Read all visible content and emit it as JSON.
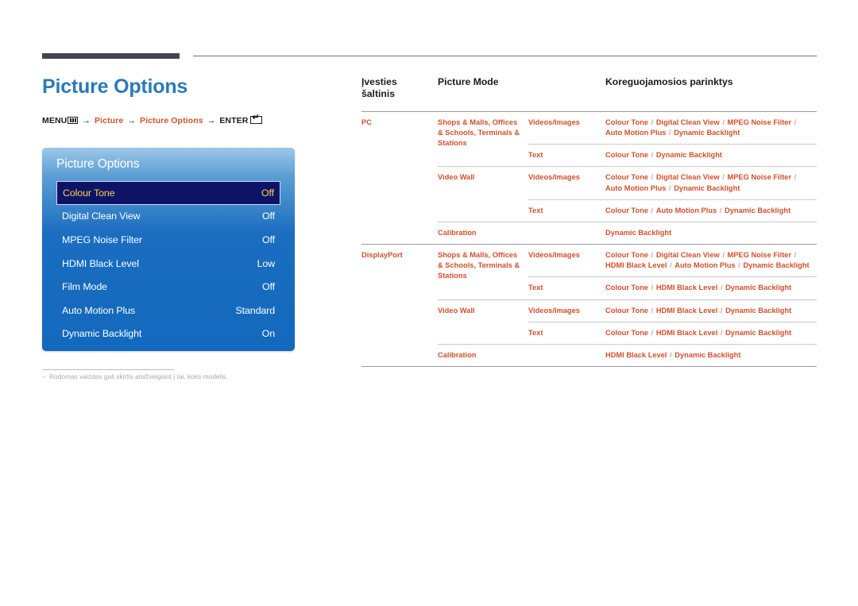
{
  "document": {
    "title": "Picture Options",
    "breadcrumb": {
      "menu_label": "MENU",
      "menu_icon": "menu-grid-icon",
      "arrow": "→",
      "item1": "Picture",
      "item2": "Picture Options",
      "enter_label": "ENTER",
      "enter_icon": "enter-return-icon"
    },
    "footnote": {
      "dash": "–",
      "text": "Rodomas vaizdas gali skirtis atsižvelgiant į tai, koks modelis."
    }
  },
  "colors": {
    "title_blue": "#2a7ab9",
    "accent_orange": "#d1502b",
    "osd_blue": "#1269bd",
    "osd_selected_bg": "#0d1466",
    "osd_selected_text": "#ffd24d",
    "rule_dark": "#44444f"
  },
  "osd": {
    "title": "Picture Options",
    "items": [
      {
        "label": "Colour Tone",
        "value": "Off",
        "selected": true
      },
      {
        "label": "Digital Clean View",
        "value": "Off",
        "selected": false
      },
      {
        "label": "MPEG Noise Filter",
        "value": "Off",
        "selected": false
      },
      {
        "label": "HDMI Black Level",
        "value": "Low",
        "selected": false
      },
      {
        "label": "Film Mode",
        "value": "Off",
        "selected": false
      },
      {
        "label": "Auto Motion Plus",
        "value": "Standard",
        "selected": false
      },
      {
        "label": "Dynamic Backlight",
        "value": "On",
        "selected": false
      }
    ]
  },
  "table": {
    "headers": {
      "col1": "Įvesties šaltinis",
      "col2": "Picture Mode",
      "col3": "",
      "col4": "Koreguojamosios parinktys"
    },
    "rows": [
      {
        "source": "PC",
        "mode": "Shops & Malls, Offices & Schools, Terminals & Stations",
        "content": "Videos/Images",
        "options": "Colour Tone / Digital Clean View / MPEG Noise Filter / Auto Motion Plus / Dynamic Backlight"
      },
      {
        "source": "",
        "mode": "",
        "content": "Text",
        "options": "Colour Tone / Dynamic Backlight"
      },
      {
        "source": "",
        "mode": "Video Wall",
        "content": "Videos/Images",
        "options": "Colour Tone / Digital Clean View / MPEG Noise Filter / Auto Motion Plus / Dynamic Backlight"
      },
      {
        "source": "",
        "mode": "",
        "content": "Text",
        "options": "Colour Tone / Auto Motion Plus / Dynamic Backlight"
      },
      {
        "source": "",
        "mode": "Calibration",
        "content": "",
        "options": "Dynamic Backlight"
      },
      {
        "source": "DisplayPort",
        "mode": "Shops & Malls, Offices & Schools, Terminals & Stations",
        "content": "Videos/Images",
        "options": "Colour Tone / Digital Clean View / MPEG Noise Filter / HDMI Black Level / Auto Motion Plus / Dynamic Backlight"
      },
      {
        "source": "",
        "mode": "",
        "content": "Text",
        "options": "Colour Tone / HDMI Black Level / Dynamic Backlight"
      },
      {
        "source": "",
        "mode": "Video Wall",
        "content": "Videos/Images",
        "options": "Colour Tone / HDMI Black Level / Dynamic Backlight"
      },
      {
        "source": "",
        "mode": "",
        "content": "Text",
        "options": "Colour Tone / HDMI Black Level / Dynamic Backlight"
      },
      {
        "source": "",
        "mode": "Calibration",
        "content": "",
        "options": "HDMI Black Level / Dynamic Backlight"
      }
    ]
  }
}
